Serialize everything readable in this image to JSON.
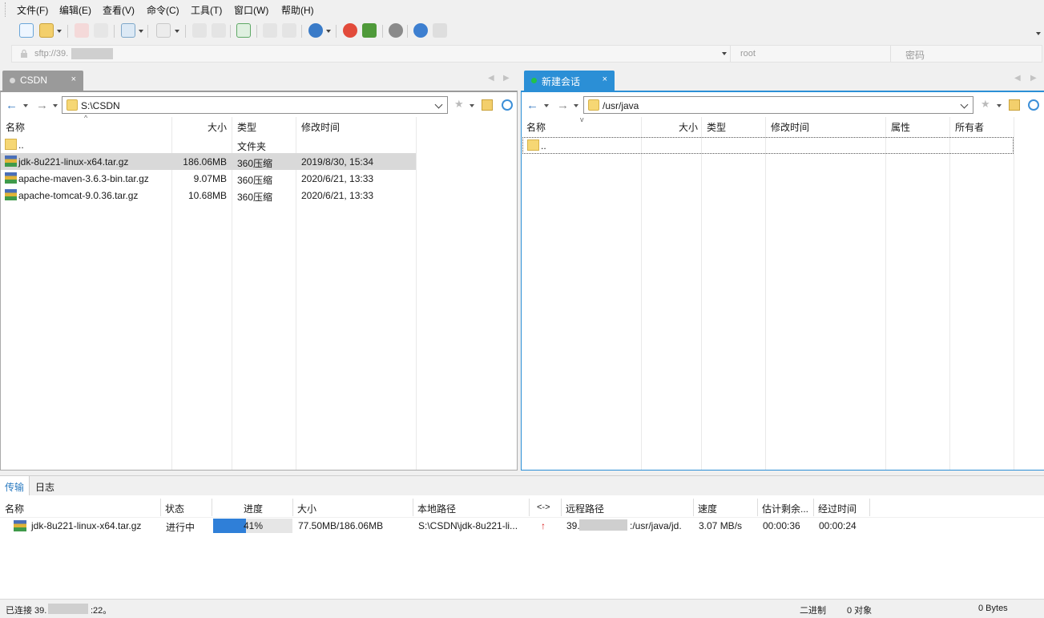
{
  "menu": [
    "文件(F)",
    "编辑(E)",
    "查看(V)",
    "命令(C)",
    "工具(T)",
    "窗口(W)",
    "帮助(H)"
  ],
  "address": {
    "host": "sftp://39.",
    "user_placeholder": "root",
    "password_placeholder": "密码"
  },
  "tabs": {
    "left": {
      "label": "CSDN",
      "close": "×"
    },
    "right": {
      "label": "新建会话",
      "close": "×"
    }
  },
  "left_pane": {
    "path": "S:\\CSDN",
    "columns": [
      "名称",
      "大小",
      "类型",
      "修改时间"
    ],
    "rows": [
      {
        "name": "..",
        "size": "",
        "type": "文件夹",
        "modified": ""
      },
      {
        "name": "jdk-8u221-linux-x64.tar.gz",
        "size": "186.06MB",
        "type": "360压缩",
        "modified": "2019/8/30, 15:34"
      },
      {
        "name": "apache-maven-3.6.3-bin.tar.gz",
        "size": "9.07MB",
        "type": "360压缩",
        "modified": "2020/6/21, 13:33"
      },
      {
        "name": "apache-tomcat-9.0.36.tar.gz",
        "size": "10.68MB",
        "type": "360压缩",
        "modified": "2020/6/21, 13:33"
      }
    ]
  },
  "right_pane": {
    "path": "/usr/java",
    "columns": [
      "名称",
      "大小",
      "类型",
      "修改时间",
      "属性",
      "所有者"
    ],
    "rows": [
      {
        "name": ".."
      }
    ]
  },
  "bottom": {
    "tabs": [
      "传输",
      "日志"
    ],
    "columns": [
      "名称",
      "状态",
      "进度",
      "大小",
      "本地路径",
      "<->",
      "远程路径",
      "速度",
      "估计剩余...",
      "经过时间"
    ],
    "transfer": {
      "name": "jdk-8u221-linux-x64.tar.gz",
      "status": "进行中",
      "progress": 41,
      "progress_label": "41%",
      "size": "77.50MB/186.06MB",
      "local_path": "S:\\CSDN\\jdk-8u221-li...",
      "direction": "↑",
      "remote_prefix": "39.",
      "remote_suffix": ":/usr/java/jd.",
      "speed": "3.07 MB/s",
      "eta": "00:00:36",
      "elapsed": "00:00:24"
    }
  },
  "status": {
    "connected_prefix": "已连接 39.",
    "connected_suffix": ":22。",
    "mode": "二进制",
    "objects": "0 对象",
    "bytes": "0 Bytes"
  },
  "colors": {
    "accent": "#2b8fd6",
    "selection": "#d9d9d9",
    "progress": "#2f7fd8"
  }
}
